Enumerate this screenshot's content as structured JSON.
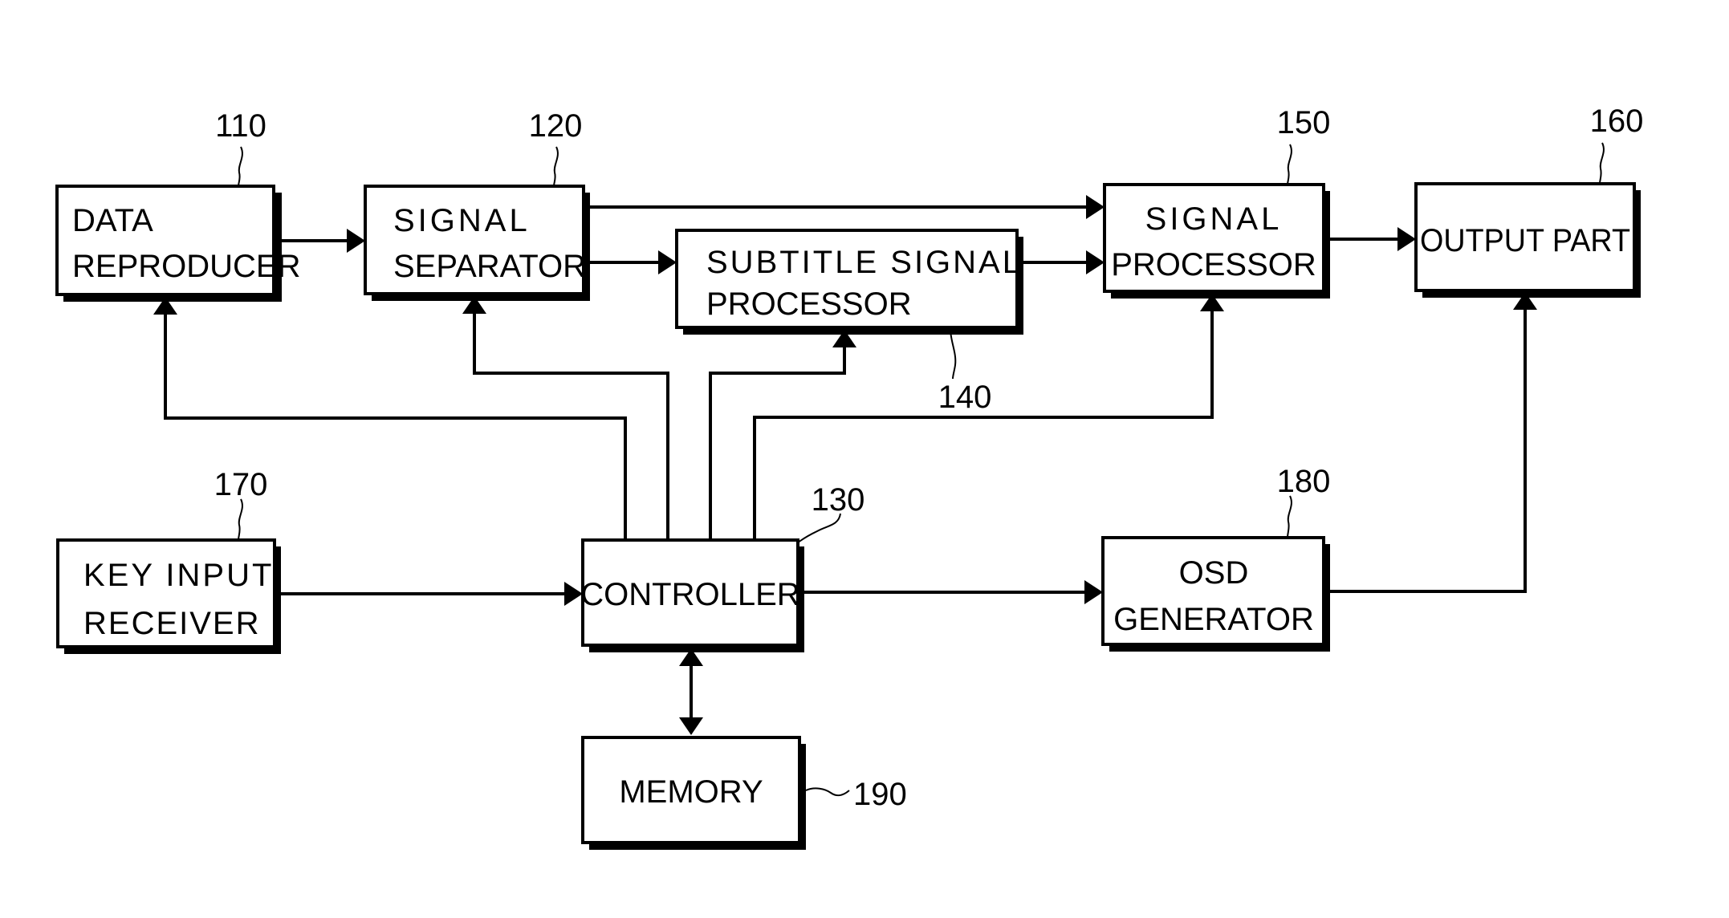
{
  "diagram": {
    "type": "block-diagram",
    "blocks": [
      {
        "id": "110",
        "lines": [
          "DATA",
          "REPRODUCER"
        ]
      },
      {
        "id": "120",
        "lines": [
          "SIGNAL",
          "SEPARATOR"
        ]
      },
      {
        "id": "140",
        "lines": [
          "SUBTITLE SIGNAL",
          "PROCESSOR"
        ]
      },
      {
        "id": "150",
        "lines": [
          "SIGNAL",
          "PROCESSOR"
        ]
      },
      {
        "id": "160",
        "lines": [
          "OUTPUT PART"
        ]
      },
      {
        "id": "170",
        "lines": [
          "KEY INPUT",
          "RECEIVER"
        ]
      },
      {
        "id": "130",
        "lines": [
          "CONTROLLER"
        ]
      },
      {
        "id": "180",
        "lines": [
          "OSD",
          "GENERATOR"
        ]
      },
      {
        "id": "190",
        "lines": [
          "MEMORY"
        ]
      }
    ],
    "refs": {
      "r110": "110",
      "r120": "120",
      "r130": "130",
      "r140": "140",
      "r150": "150",
      "r160": "160",
      "r170": "170",
      "r180": "180",
      "r190": "190"
    },
    "connections": [
      {
        "from": "110",
        "to": "120",
        "direction": "forward"
      },
      {
        "from": "120",
        "to": "150",
        "direction": "forward"
      },
      {
        "from": "120",
        "to": "140",
        "direction": "forward"
      },
      {
        "from": "140",
        "to": "150",
        "direction": "forward"
      },
      {
        "from": "150",
        "to": "160",
        "direction": "forward"
      },
      {
        "from": "170",
        "to": "130",
        "direction": "forward"
      },
      {
        "from": "130",
        "to": "110",
        "direction": "forward"
      },
      {
        "from": "130",
        "to": "120",
        "direction": "forward"
      },
      {
        "from": "130",
        "to": "140",
        "direction": "forward"
      },
      {
        "from": "130",
        "to": "150",
        "direction": "forward"
      },
      {
        "from": "130",
        "to": "180",
        "direction": "forward"
      },
      {
        "from": "180",
        "to": "160",
        "direction": "forward"
      },
      {
        "from": "130",
        "to": "190",
        "direction": "bidirectional"
      }
    ]
  }
}
